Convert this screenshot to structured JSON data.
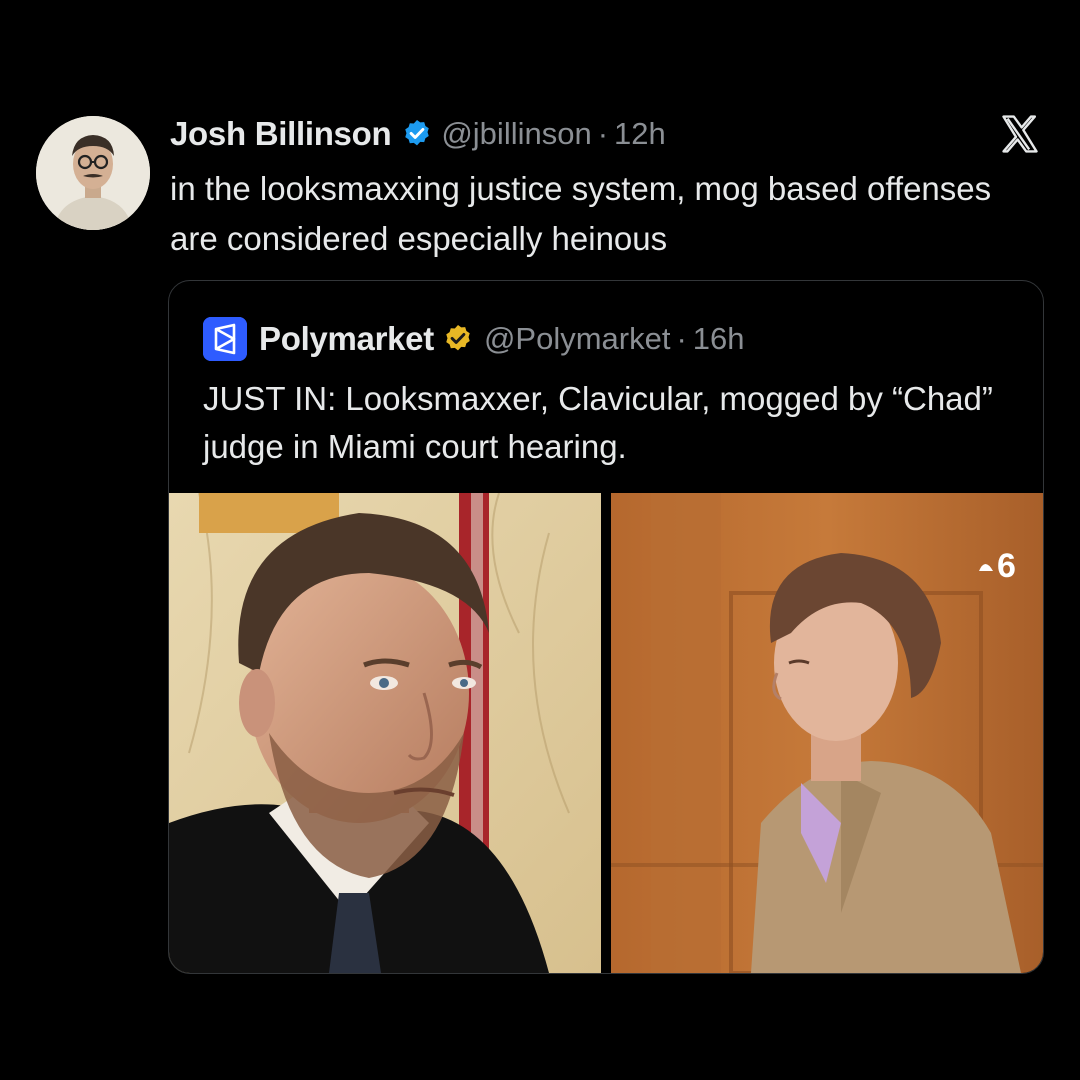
{
  "tweet": {
    "author_name": "Josh Billinson",
    "handle": "@jbillinson",
    "separator": "·",
    "time": "12h",
    "text": "in the looksmaxxing justice system, mog based offenses are considered especially heinous",
    "verified_color": "#1d9bf0",
    "icons": {
      "avatar": "profile-photo",
      "verified": "verified-badge-icon",
      "platform": "x-logo-icon"
    }
  },
  "quoted_tweet": {
    "author_name": "Polymarket",
    "handle": "@Polymarket",
    "separator": "·",
    "time": "16h",
    "text": "JUST IN: Looksmaxxer, Clavicular, mogged by “Chad” judge in Miami court hearing.",
    "verified_color": "#e8b825",
    "logo_color": "#2e5cff",
    "icons": {
      "logo": "polymarket-logo-icon",
      "verified": "gold-verified-badge-icon"
    },
    "media": [
      {
        "name": "judge-photo",
        "description_icon": "judge-portrait"
      },
      {
        "name": "courtroom-photo",
        "description_icon": "young-man-in-suit",
        "watermark": "6"
      }
    ]
  },
  "colors": {
    "background": "#000000",
    "text": "#e7e9ea",
    "muted": "#8b8f94",
    "border": "#333639"
  }
}
